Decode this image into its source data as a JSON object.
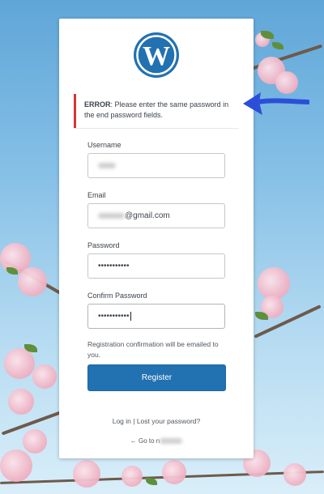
{
  "error": {
    "strong": "ERROR",
    "message": ": Please enter the same password in the end password fields."
  },
  "form": {
    "username_label": "Username",
    "email_label": "Email",
    "email_value": "@gmail.com",
    "password_label": "Password",
    "password_value": "•••••••••••",
    "confirm_label": "Confirm Password",
    "confirm_value": "•••••••••••",
    "note": "Registration confirmation will be emailed to you.",
    "register_label": "Register"
  },
  "footer": {
    "login": "Log in",
    "separator": " | ",
    "lost_password": "Lost your password?",
    "goto_prefix": "← Go to n"
  },
  "colors": {
    "accent": "#2271b1",
    "error": "#d63638",
    "annotation_arrow": "#2b4fd9"
  },
  "icons": {
    "logo": "wordpress-logo",
    "arrow": "annotation-arrow"
  }
}
